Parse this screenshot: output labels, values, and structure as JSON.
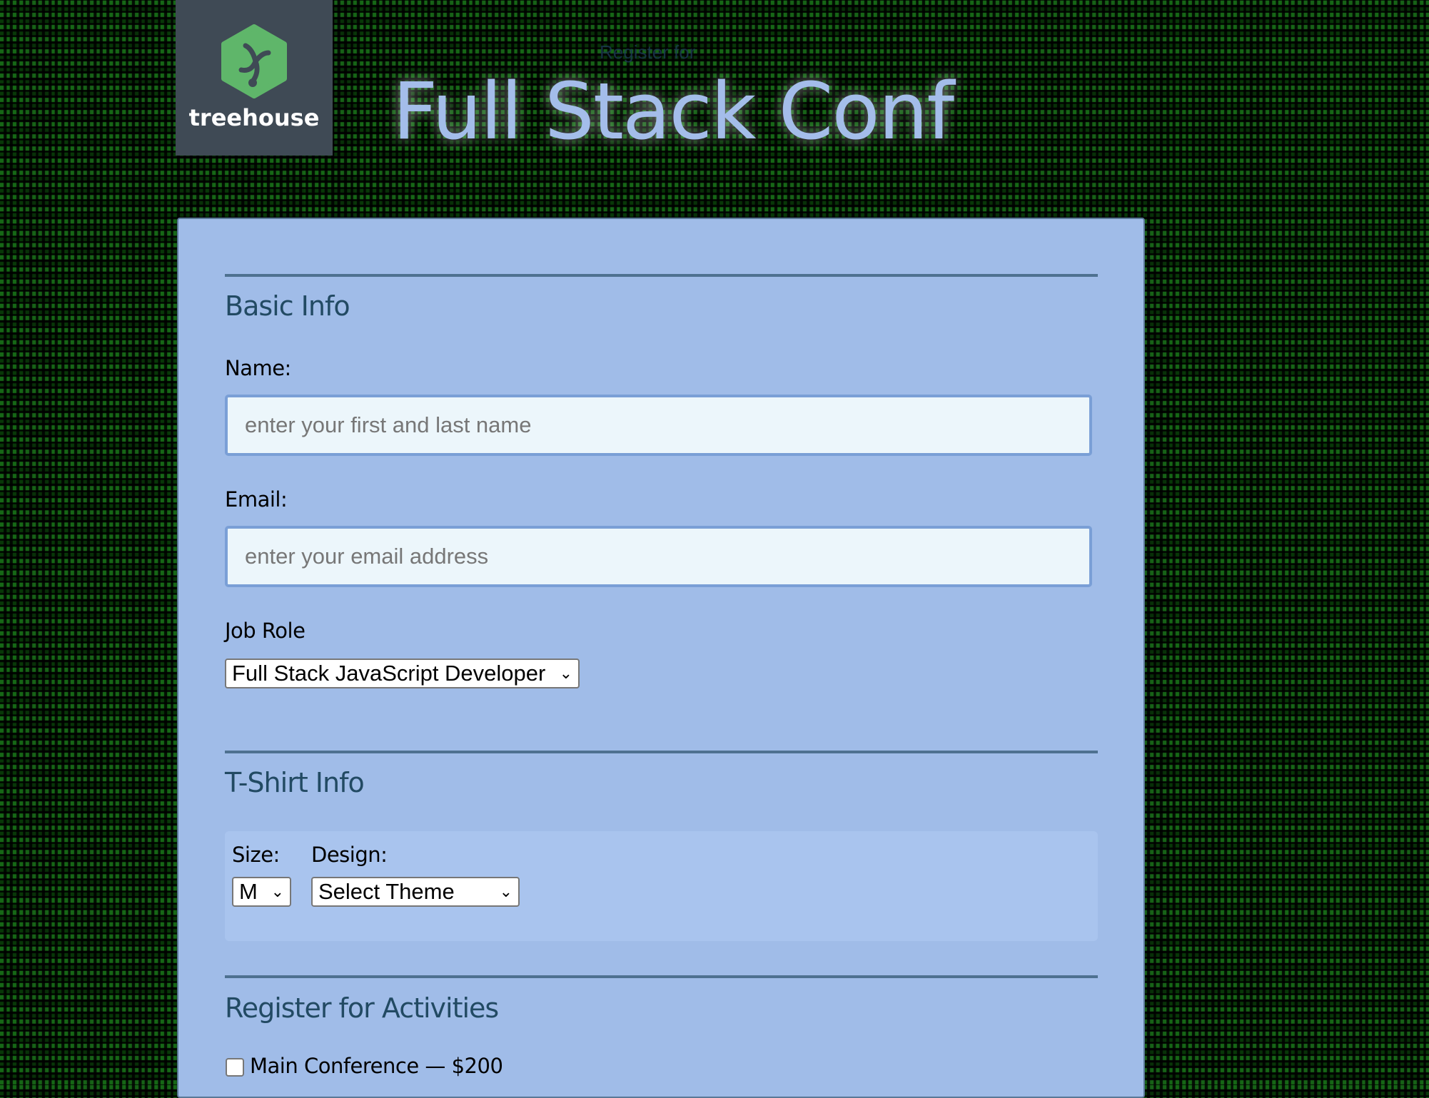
{
  "header": {
    "logo_text": "treehouse",
    "register_for": "Register for",
    "title": "Full Stack Conf"
  },
  "basic_info": {
    "heading": "Basic Info",
    "name_label": "Name:",
    "name_placeholder": "enter your first and last name",
    "email_label": "Email:",
    "email_placeholder": "enter your email address",
    "job_role_label": "Job Role",
    "job_role_value": "Full Stack JavaScript Developer"
  },
  "tshirt": {
    "heading": "T-Shirt Info",
    "size_label": "Size:",
    "size_value": "M",
    "design_label": "Design:",
    "design_value": "Select Theme"
  },
  "activities": {
    "heading": "Register for Activities",
    "items": [
      {
        "label": "Main Conference — $200",
        "checked": false
      }
    ]
  },
  "colors": {
    "panel": "#a0bce8",
    "heading": "#224a63",
    "logo_green": "#5fb66a"
  }
}
